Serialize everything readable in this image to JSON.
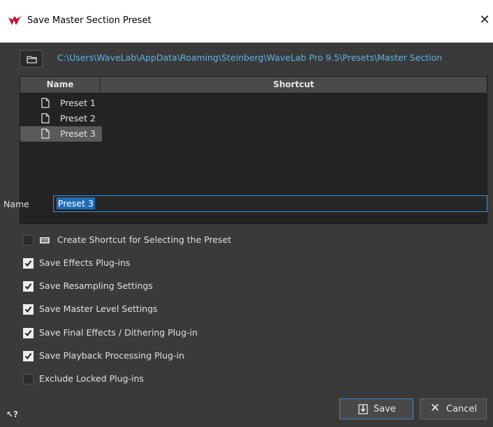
{
  "window": {
    "title": "Save Master Section Preset",
    "close_glyph": "✕"
  },
  "path": "C:\\Users\\WaveLab\\AppData\\Roaming\\Steinberg\\WaveLab Pro 9.5\\Presets\\Master Section",
  "table": {
    "columns": [
      "Name",
      "Shortcut"
    ],
    "rows": [
      {
        "name": "Preset 1",
        "shortcut": "",
        "selected": false
      },
      {
        "name": "Preset 2",
        "shortcut": "",
        "selected": false
      },
      {
        "name": "Preset 3",
        "shortcut": "",
        "selected": true
      }
    ]
  },
  "name_field": {
    "label": "Name",
    "value": "Preset 3"
  },
  "options": [
    {
      "label": "Create Shortcut for Selecting the Preset",
      "checked": false,
      "icon": "keyboard-icon"
    },
    {
      "label": "Save Effects Plug-ins",
      "checked": true
    },
    {
      "label": "Save Resampling Settings",
      "checked": true
    },
    {
      "label": "Save Master Level Settings",
      "checked": true
    },
    {
      "label": "Save Final Effects / Dithering Plug-in",
      "checked": true
    },
    {
      "label": "Save Playback Processing Plug-in",
      "checked": true
    },
    {
      "label": "Exclude Locked Plug-ins",
      "checked": false
    }
  ],
  "help_glyph": "↖?",
  "buttons": {
    "save_label": "Save",
    "cancel_label": "Cancel"
  },
  "colors": {
    "path_link": "#5fb3e8",
    "accent": "#3a8ed8",
    "dialog_bg": "#3a3a3a"
  }
}
